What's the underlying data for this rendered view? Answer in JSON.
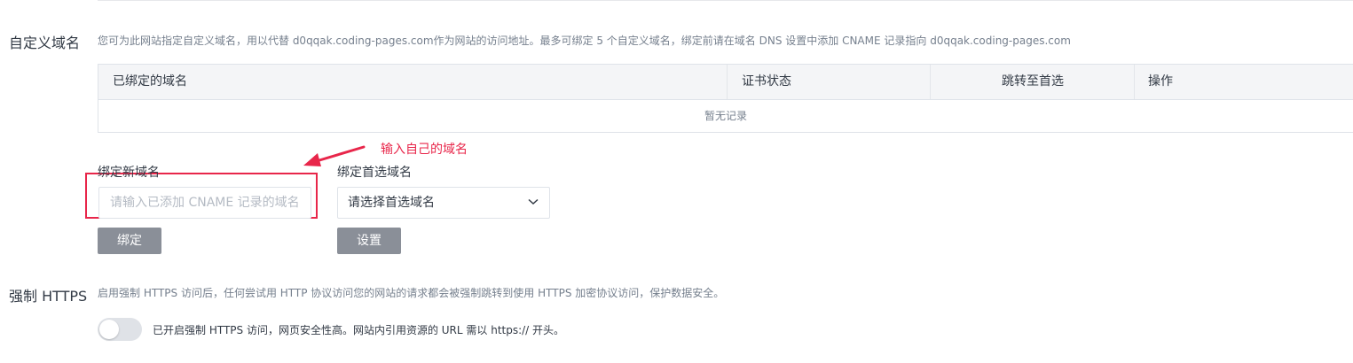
{
  "custom_domain": {
    "title": "自定义域名",
    "description": "您可为此网站指定自定义域名，用以代替 d0qqak.coding-pages.com作为网站的访问地址。最多可绑定 5 个自定义域名，绑定前请在域名 DNS 设置中添加 CNAME 记录指向 d0qqak.coding-pages.com",
    "table": {
      "columns": [
        "已绑定的域名",
        "证书状态",
        "跳转至首选",
        "操作"
      ],
      "empty_text": "暂无记录"
    },
    "bind_new": {
      "label": "绑定新域名",
      "placeholder": "请输入已添加 CNAME 记录的域名",
      "value": "",
      "button": "绑定"
    },
    "preferred": {
      "label": "绑定首选域名",
      "selected": "请选择首选域名",
      "button": "设置"
    }
  },
  "annotation": {
    "text": "输入自己的域名",
    "color": "#e8264a"
  },
  "https": {
    "title": "强制 HTTPS",
    "description": "启用强制 HTTPS 访问后，任何尝试用 HTTP 协议访问您的网站的请求都会被强制跳转到使用 HTTPS 加密协议访问，保护数据安全。",
    "toggle_on": false,
    "toggle_label": "已开启强制 HTTPS 访问，网页安全性高。网站内引用资源的 URL 需以 https:// 开头。"
  },
  "colors": {
    "primary_text": "#323a45",
    "secondary_text": "#76808e",
    "button_disabled": "#8a8f98",
    "annotation": "#e8264a"
  }
}
